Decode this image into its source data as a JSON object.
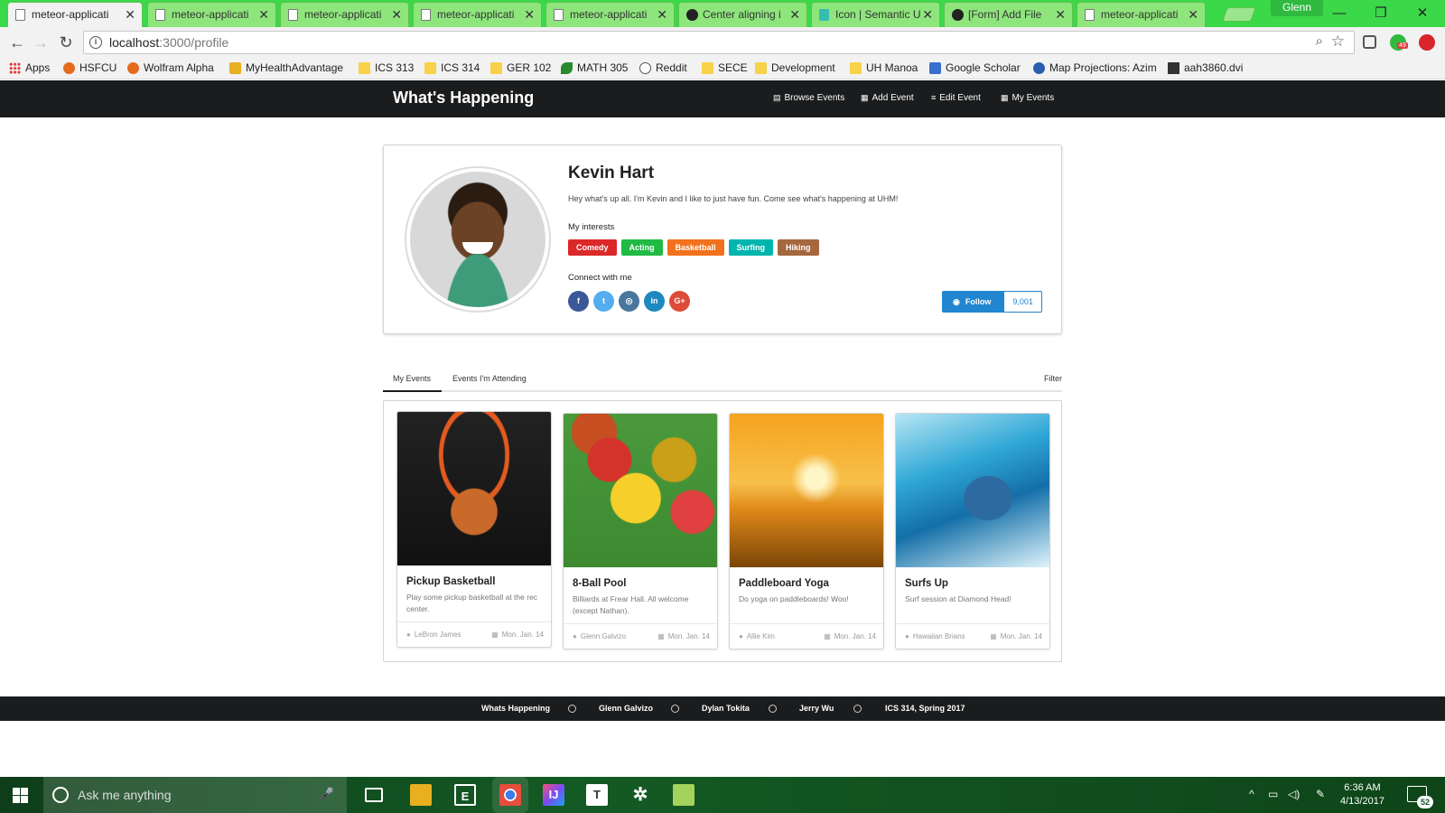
{
  "browser": {
    "tabs": [
      {
        "label": "meteor-applicati",
        "icon": "page-icon",
        "active": true
      },
      {
        "label": "meteor-applicati",
        "icon": "page-icon"
      },
      {
        "label": "meteor-applicati",
        "icon": "page-icon"
      },
      {
        "label": "meteor-applicati",
        "icon": "page-icon"
      },
      {
        "label": "meteor-applicati",
        "icon": "page-icon"
      },
      {
        "label": "Center aligning i",
        "icon": "github-icon"
      },
      {
        "label": "Icon | Semantic U",
        "icon": "semantic-icon"
      },
      {
        "label": "[Form] Add File",
        "icon": "github-icon"
      },
      {
        "label": "meteor-applicati",
        "icon": "page-icon"
      }
    ],
    "profile_name": "Glenn",
    "url_host": "localhost",
    "url_path": ":3000/profile",
    "extension_badge": "49",
    "bookmarks": [
      {
        "label": "Apps",
        "icon": "apps-icon"
      },
      {
        "label": "HSFCU",
        "icon": "hsfcu-icon"
      },
      {
        "label": "Wolfram Alpha",
        "icon": "wolfram-icon"
      },
      {
        "label": "MyHealthAdvantage",
        "icon": "health-icon"
      },
      {
        "label": "ICS 313",
        "icon": "folder-icon"
      },
      {
        "label": "ICS 314",
        "icon": "folder-icon"
      },
      {
        "label": "GER 102",
        "icon": "folder-icon"
      },
      {
        "label": "MATH 305",
        "icon": "leaf-icon"
      },
      {
        "label": "Reddit",
        "icon": "reddit-icon"
      },
      {
        "label": "SECE",
        "icon": "folder-icon"
      },
      {
        "label": "Development",
        "icon": "folder-icon"
      },
      {
        "label": "UH Manoa",
        "icon": "folder-icon"
      },
      {
        "label": "Google Scholar",
        "icon": "scholar-icon"
      },
      {
        "label": "Map Projections: Azim",
        "icon": "globe-icon"
      },
      {
        "label": "aah3860.dvi",
        "icon": "dvi-icon"
      }
    ]
  },
  "navbar": {
    "brand": "What's Happening",
    "items": [
      {
        "label": "Browse Events",
        "icon": "list-icon"
      },
      {
        "label": "Add Event",
        "icon": "calendar-plus-icon"
      },
      {
        "label": "Edit Event",
        "icon": "edit-list-icon"
      },
      {
        "label": "My Events",
        "icon": "calendar-icon"
      }
    ]
  },
  "profile": {
    "name": "Kevin Hart",
    "bio": "Hey what's up all. I'm Kevin and I like to just have fun. Come see what's happening at UHM!",
    "interests_label": "My interests",
    "interests": [
      {
        "label": "Comedy",
        "color": "#db2828"
      },
      {
        "label": "Acting",
        "color": "#21ba45"
      },
      {
        "label": "Basketball",
        "color": "#f2711c"
      },
      {
        "label": "Surfing",
        "color": "#00b5ad"
      },
      {
        "label": "Hiking",
        "color": "#a5673f"
      }
    ],
    "connect_label": "Connect with me",
    "socials": [
      {
        "name": "facebook",
        "glyph": "f",
        "color": "#3b5998"
      },
      {
        "name": "twitter",
        "glyph": "t",
        "color": "#55acee"
      },
      {
        "name": "instagram",
        "glyph": "◎",
        "color": "#49769c"
      },
      {
        "name": "linkedin",
        "glyph": "in",
        "color": "#1f88be"
      },
      {
        "name": "google-plus",
        "glyph": "G+",
        "color": "#dd4b39"
      }
    ],
    "follow_label": "Follow",
    "follow_count": "9,001"
  },
  "tabs": {
    "my_events": "My Events",
    "attending": "Events I'm Attending",
    "filter": "Filter"
  },
  "events": [
    {
      "title": "Pickup Basketball",
      "description": "Play some pickup basketball at the rec center.",
      "host": "LeBron James",
      "date": "Mon. Jan. 14",
      "image": "basketball"
    },
    {
      "title": "8-Ball Pool",
      "description": "Billiards at Frear Hall. All welcome (except Nathan).",
      "host": "Glenn Galvizo",
      "date": "Mon. Jan. 14",
      "image": "pool"
    },
    {
      "title": "Paddleboard Yoga",
      "description": "Do yoga on paddleboards! Woo!",
      "host": "Allie Kim",
      "date": "Mon. Jan. 14",
      "image": "yoga"
    },
    {
      "title": "Surfs Up",
      "description": "Surf session at Diamond Head!",
      "host": "Hawaiian Brians",
      "date": "Mon. Jan. 14",
      "image": "surf"
    }
  ],
  "footer": {
    "items": [
      "Whats Happening",
      "Glenn Galvizo",
      "Dylan Tokita",
      "Jerry Wu",
      "ICS 314, Spring 2017"
    ]
  },
  "taskbar": {
    "search_placeholder": "Ask me anything",
    "time": "6:36 AM",
    "date": "4/13/2017",
    "notification_count": "52"
  }
}
